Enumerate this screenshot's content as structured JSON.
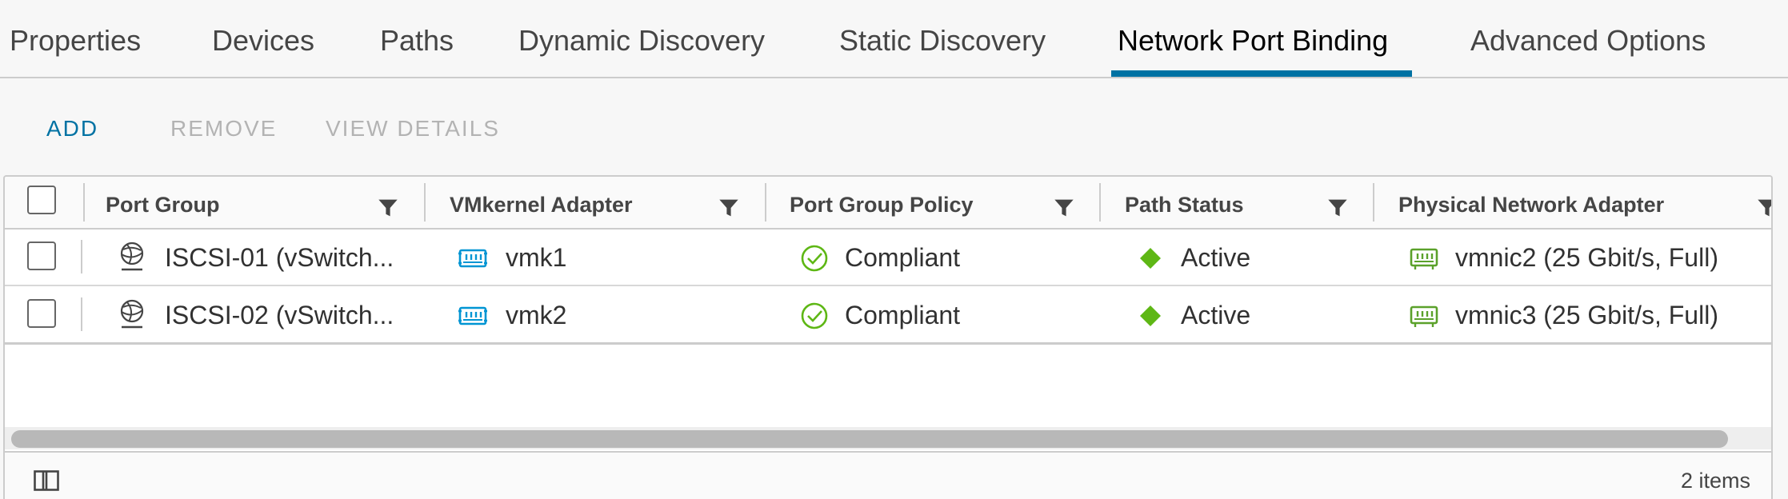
{
  "tabs": [
    {
      "label": "Properties",
      "active": false
    },
    {
      "label": "Devices",
      "active": false
    },
    {
      "label": "Paths",
      "active": false
    },
    {
      "label": "Dynamic Discovery",
      "active": false
    },
    {
      "label": "Static Discovery",
      "active": false
    },
    {
      "label": "Network Port Binding",
      "active": true
    },
    {
      "label": "Advanced Options",
      "active": false
    }
  ],
  "actions": {
    "add": "ADD",
    "remove": "REMOVE",
    "view_details": "VIEW DETAILS"
  },
  "table": {
    "columns": [
      "Port Group",
      "VMkernel Adapter",
      "Port Group Policy",
      "Path Status",
      "Physical Network Adapter"
    ],
    "rows": [
      {
        "port_group": "ISCSI-01 (vSwitch...",
        "vmkernel_adapter": "vmk1",
        "port_group_policy": "Compliant",
        "path_status": "Active",
        "physical_network_adapter": "vmnic2 (25 Gbit/s, Full)"
      },
      {
        "port_group": "ISCSI-02 (vSwitch...",
        "vmkernel_adapter": "vmk2",
        "port_group_policy": "Compliant",
        "path_status": "Active",
        "physical_network_adapter": "vmnic3 (25 Gbit/s, Full)"
      }
    ]
  },
  "footer": {
    "item_count": "2 items"
  },
  "icons": {
    "port_group": "port-group-icon",
    "vmkernel": "vmkernel-adapter-icon",
    "compliant": "check-circle-icon",
    "active": "green-diamond-icon",
    "physical_nic": "physical-nic-icon",
    "filter": "filter-icon",
    "column_toggle": "column-toggle-icon"
  },
  "colors": {
    "accent": "#0072a3",
    "success": "#5eb715",
    "nic_green": "#5ba12b",
    "vmk_blue": "#0095d3"
  }
}
